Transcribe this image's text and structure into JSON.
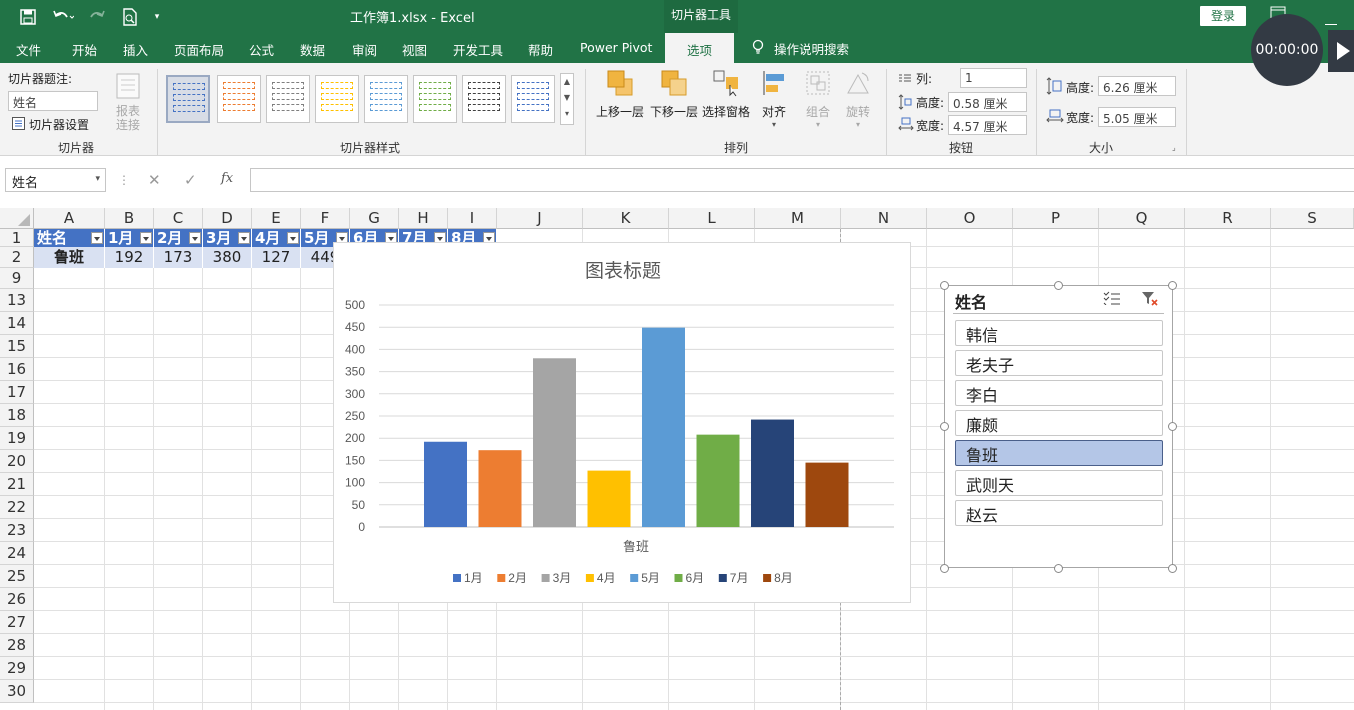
{
  "title_bar": {
    "document_title": "工作簿1.xlsx  -  Excel",
    "contextual_tab_title": "切片器工具",
    "login_label": "登录",
    "qat_icons": [
      "save-icon",
      "undo-icon",
      "redo-icon",
      "print-preview-icon",
      "customize-qat-icon"
    ]
  },
  "ribbon_tabs": {
    "items": [
      "文件",
      "开始",
      "插入",
      "页面布局",
      "公式",
      "数据",
      "审阅",
      "视图",
      "开发工具",
      "帮助",
      "Power Pivot",
      "选项"
    ],
    "active": "选项",
    "tell_me": "操作说明搜索"
  },
  "recorder": {
    "time": "00:00:00"
  },
  "ribbon": {
    "slicer_group": {
      "caption_label": "切片器题注:",
      "caption_value": "姓名",
      "settings_label": "切片器设置",
      "report_connections_line1": "报表",
      "report_connections_line2": "连接",
      "group_label": "切片器"
    },
    "styles_group": {
      "group_label": "切片器样式",
      "accent_colors": [
        "#4472c4",
        "#ed7d31",
        "#7f7f7f",
        "#ffc000",
        "#5b9bd5",
        "#70ad47",
        "#404040",
        "#4472c4"
      ]
    },
    "arrange_group": {
      "bring_forward": "上移一层",
      "send_backward": "下移一层",
      "selection_pane": "选择窗格",
      "align": "对齐",
      "group": "组合",
      "rotate": "旋转",
      "group_label": "排列"
    },
    "buttons_group": {
      "columns_label": "列:",
      "columns_value": "1",
      "height_label": "高度:",
      "height_value": "0.58 厘米",
      "width_label": "宽度:",
      "width_value": "4.57 厘米",
      "group_label": "按钮"
    },
    "size_group": {
      "height_label": "高度:",
      "height_value": "6.26 厘米",
      "width_label": "宽度:",
      "width_value": "5.05 厘米",
      "group_label": "大小"
    }
  },
  "formula_bar": {
    "name_box": "姓名",
    "fx_label": "fx",
    "formula": ""
  },
  "sheet": {
    "columns": [
      "A",
      "B",
      "C",
      "D",
      "E",
      "F",
      "G",
      "H",
      "I",
      "J",
      "K",
      "L",
      "M",
      "N",
      "O",
      "P",
      "Q",
      "R",
      "S"
    ],
    "rows": [
      "1",
      "2",
      "9",
      "13",
      "14",
      "15",
      "16",
      "17",
      "18",
      "19",
      "20",
      "21",
      "22",
      "23",
      "24",
      "25",
      "26",
      "27",
      "28",
      "29",
      "30"
    ],
    "header_row": [
      "姓名",
      "1月",
      "2月",
      "3月",
      "4月",
      "5月",
      "6月",
      "7月",
      "8月"
    ],
    "data_row": [
      "鲁班",
      "192",
      "173",
      "380",
      "127",
      "449"
    ]
  },
  "chart_data": {
    "type": "bar",
    "title": "图表标题",
    "categories": [
      "鲁班"
    ],
    "series": [
      {
        "name": "1月",
        "values": [
          192
        ],
        "color": "#4472c4"
      },
      {
        "name": "2月",
        "values": [
          173
        ],
        "color": "#ed7d31"
      },
      {
        "name": "3月",
        "values": [
          380
        ],
        "color": "#a5a5a5"
      },
      {
        "name": "4月",
        "values": [
          127
        ],
        "color": "#ffc000"
      },
      {
        "name": "5月",
        "values": [
          449
        ],
        "color": "#5b9bd5"
      },
      {
        "name": "6月",
        "values": [
          208
        ],
        "color": "#70ad47"
      },
      {
        "name": "7月",
        "values": [
          242
        ],
        "color": "#264478"
      },
      {
        "name": "8月",
        "values": [
          145
        ],
        "color": "#9e480e"
      }
    ],
    "ylim": [
      0,
      500
    ],
    "yticks": [
      "0",
      "50",
      "100",
      "150",
      "200",
      "250",
      "300",
      "350",
      "400",
      "450",
      "500"
    ],
    "grid": true,
    "legend_position": "bottom"
  },
  "slicer": {
    "title": "姓名",
    "multi_select_icon": "multi-select-icon",
    "clear_filter_icon": "clear-filter-icon",
    "items": [
      "韩信",
      "老夫子",
      "李白",
      "廉颇",
      "鲁班",
      "武则天",
      "赵云"
    ],
    "selected": "鲁班"
  }
}
